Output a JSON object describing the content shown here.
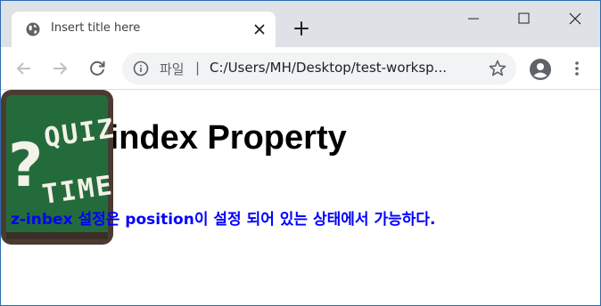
{
  "browser": {
    "tab": {
      "title": "Insert title here"
    },
    "address": {
      "site_label": "파일",
      "separator": "|",
      "url": "C:/Users/MH/Desktop/test-worksp..."
    }
  },
  "page": {
    "heading": "z-index Property",
    "image_text": [
      "QUIZ",
      "TIME"
    ],
    "paragraph": "z-inbex 설정은 position이 설정 되어 있는 상태에서 가능하다.",
    "colors": {
      "paragraph": "#0000ff",
      "board": "#246b3c",
      "board_frame": "#4a3b32"
    }
  }
}
